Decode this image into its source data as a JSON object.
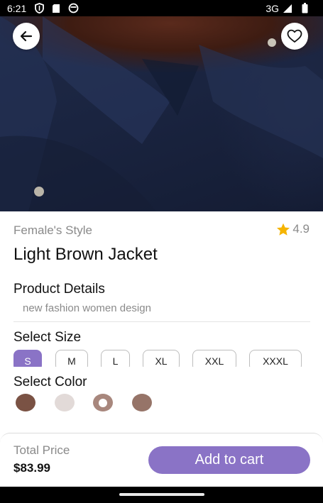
{
  "status_bar": {
    "time": "6:21",
    "network": "3G",
    "icons": [
      "shield-icon",
      "sd-card-icon",
      "app-notification-icon",
      "signal-icon",
      "battery-icon"
    ]
  },
  "hero": {
    "back_icon": "arrow-left-icon",
    "favorite_icon": "heart-outline-icon"
  },
  "product": {
    "brand": "Female's Style",
    "rating": "4.9",
    "rating_color": "#f5b400",
    "title": "Light Brown Jacket",
    "details_heading": "Product Details",
    "description": "new fashion women design"
  },
  "size": {
    "heading": "Select Size",
    "options": [
      "S",
      "M",
      "L",
      "XL",
      "XXL",
      "XXXL"
    ],
    "selected": "S"
  },
  "color": {
    "heading": "Select Color",
    "options": [
      "#7a5244",
      "#e2dad8",
      "#a8877d",
      "#967468"
    ],
    "selected_index": 2
  },
  "checkout": {
    "total_label": "Total Price",
    "total_value": "$83.99",
    "button_label": "Add to cart",
    "accent_color": "#8a73c6"
  }
}
